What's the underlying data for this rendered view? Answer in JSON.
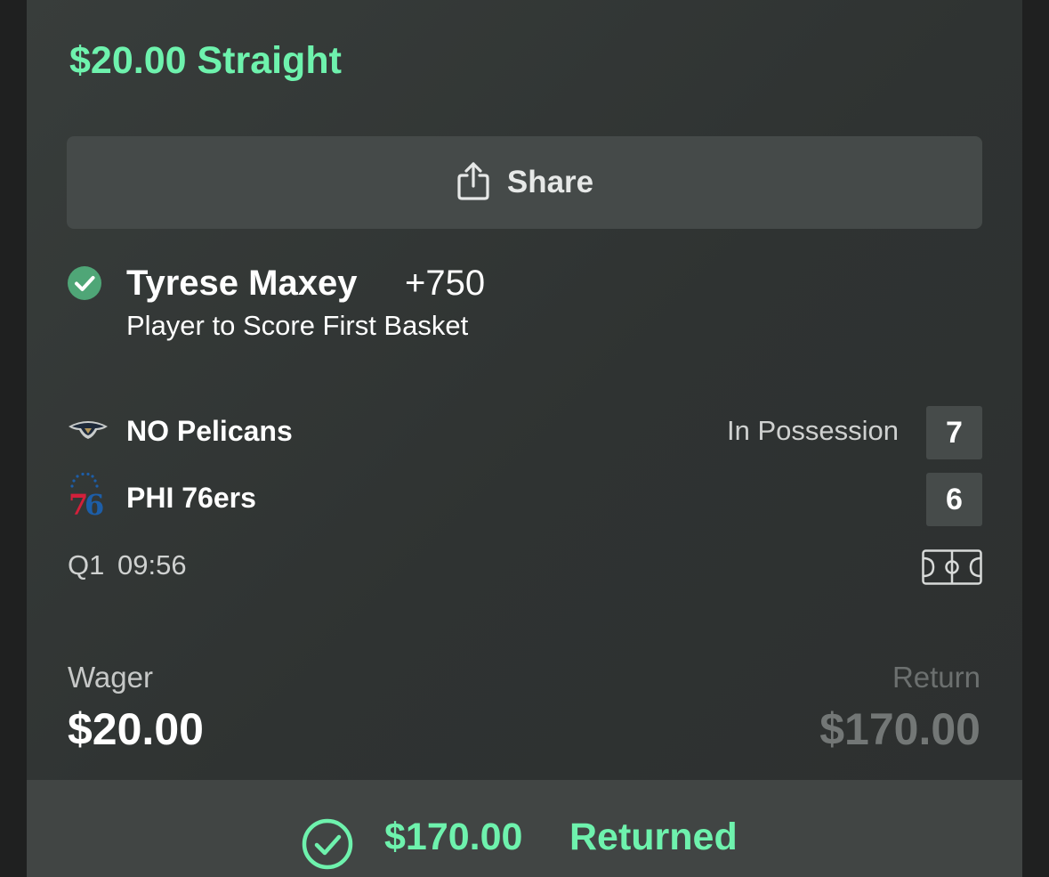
{
  "bet": {
    "title": "$20.00 Straight",
    "share_label": "Share",
    "selection": {
      "player": "Tyrese Maxey",
      "odds": "+750",
      "market": "Player to Score First Basket",
      "status_icon": "check-circle-icon"
    }
  },
  "game": {
    "teams": [
      {
        "name": "NO Pelicans",
        "logo": "pelicans-logo",
        "status": "In Possession",
        "score": "7"
      },
      {
        "name": "PHI 76ers",
        "logo": "76ers-logo",
        "status": "",
        "score": "6"
      }
    ],
    "period": "Q1",
    "clock": "09:56",
    "court_icon": "basketball-court-icon"
  },
  "summary": {
    "wager_label": "Wager",
    "wager_value": "$20.00",
    "return_label": "Return",
    "return_value": "$170.00"
  },
  "footer": {
    "amount": "$170.00",
    "status": "Returned",
    "icon": "check-circle-icon"
  },
  "colors": {
    "accent_green": "#6ef2ad",
    "card_bg": "#343837",
    "button_bg": "#454a49",
    "score_bg": "#464b4a"
  }
}
